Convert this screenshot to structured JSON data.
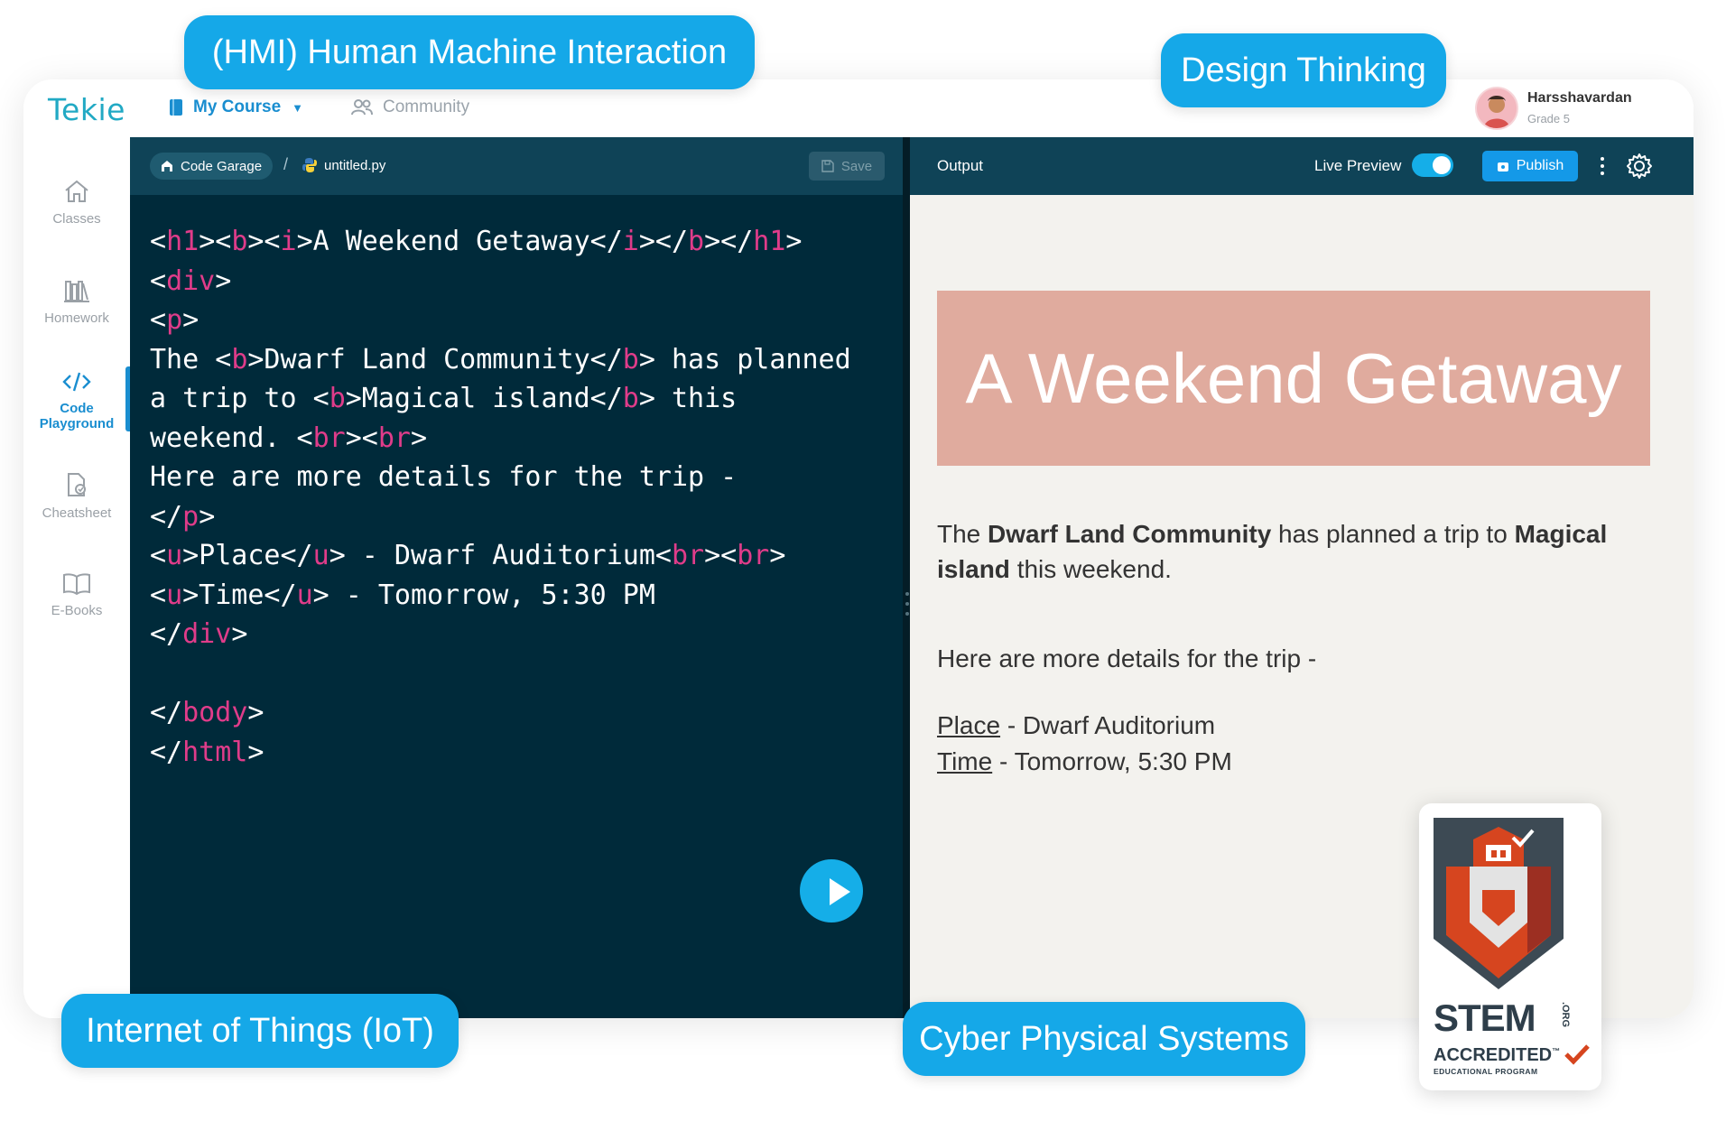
{
  "brand": {
    "logo": "Tekie"
  },
  "nav": {
    "my_course": "My Course",
    "community": "Community"
  },
  "user": {
    "name": "Harsshavardan",
    "grade": "Grade 5"
  },
  "sidebar": {
    "items": [
      {
        "label": "Classes",
        "icon": "home-icon"
      },
      {
        "label": "Homework",
        "icon": "books-icon"
      },
      {
        "label_line1": "Code",
        "label_line2": "Playground",
        "icon": "code-icon",
        "active": true
      },
      {
        "label": "Cheatsheet",
        "icon": "cheatsheet-icon"
      },
      {
        "label": "E-Books",
        "icon": "book-open-icon"
      }
    ]
  },
  "editor": {
    "breadcrumb_root": "Code Garage",
    "separator": "/",
    "file_name": "untitled.py",
    "save_label": "Save",
    "code_lines": [
      [
        {
          "t": "<",
          "c": "w"
        },
        {
          "t": "h1",
          "c": "p"
        },
        {
          "t": "><",
          "c": "w"
        },
        {
          "t": "b",
          "c": "p"
        },
        {
          "t": "><",
          "c": "w"
        },
        {
          "t": "i",
          "c": "p"
        },
        {
          "t": ">A Weekend Getaway</",
          "c": "w"
        },
        {
          "t": "i",
          "c": "p"
        },
        {
          "t": "></",
          "c": "w"
        },
        {
          "t": "b",
          "c": "p"
        },
        {
          "t": "></",
          "c": "w"
        },
        {
          "t": "h1",
          "c": "p"
        },
        {
          "t": ">",
          "c": "w"
        }
      ],
      [
        {
          "t": "<",
          "c": "w"
        },
        {
          "t": "div",
          "c": "p"
        },
        {
          "t": ">",
          "c": "w"
        }
      ],
      [
        {
          "t": "<",
          "c": "w"
        },
        {
          "t": "p",
          "c": "p"
        },
        {
          "t": ">",
          "c": "w"
        }
      ],
      [
        {
          "t": "The <",
          "c": "w"
        },
        {
          "t": "b",
          "c": "p"
        },
        {
          "t": ">Dwarf Land Community</",
          "c": "w"
        },
        {
          "t": "b",
          "c": "p"
        },
        {
          "t": "> has planned",
          "c": "w"
        }
      ],
      [
        {
          "t": "a trip to <",
          "c": "w"
        },
        {
          "t": "b",
          "c": "p"
        },
        {
          "t": ">Magical island</",
          "c": "w"
        },
        {
          "t": "b",
          "c": "p"
        },
        {
          "t": "> this",
          "c": "w"
        }
      ],
      [
        {
          "t": "weekend. <",
          "c": "w"
        },
        {
          "t": "br",
          "c": "p"
        },
        {
          "t": "><",
          "c": "w"
        },
        {
          "t": "br",
          "c": "p"
        },
        {
          "t": ">",
          "c": "w"
        }
      ],
      [
        {
          "t": "Here are more details for the trip -",
          "c": "w"
        }
      ],
      [
        {
          "t": "</",
          "c": "w"
        },
        {
          "t": "p",
          "c": "p"
        },
        {
          "t": ">",
          "c": "w"
        }
      ],
      [
        {
          "t": "<",
          "c": "w"
        },
        {
          "t": "u",
          "c": "p"
        },
        {
          "t": ">Place</",
          "c": "w"
        },
        {
          "t": "u",
          "c": "p"
        },
        {
          "t": "> - Dwarf Auditorium<",
          "c": "w"
        },
        {
          "t": "br",
          "c": "p"
        },
        {
          "t": "><",
          "c": "w"
        },
        {
          "t": "br",
          "c": "p"
        },
        {
          "t": ">",
          "c": "w"
        }
      ],
      [
        {
          "t": "<",
          "c": "w"
        },
        {
          "t": "u",
          "c": "p"
        },
        {
          "t": ">Time</",
          "c": "w"
        },
        {
          "t": "u",
          "c": "p"
        },
        {
          "t": "> - Tomorrow, 5:30 PM",
          "c": "w"
        }
      ],
      [
        {
          "t": "</",
          "c": "w"
        },
        {
          "t": "div",
          "c": "p"
        },
        {
          "t": ">",
          "c": "w"
        }
      ],
      [],
      [
        {
          "t": "</",
          "c": "w"
        },
        {
          "t": "body",
          "c": "p"
        },
        {
          "t": ">",
          "c": "w"
        }
      ],
      [
        {
          "t": "</",
          "c": "w"
        },
        {
          "t": "html",
          "c": "p"
        },
        {
          "t": ">",
          "c": "w"
        }
      ]
    ]
  },
  "output": {
    "title": "Output",
    "live_preview_label": "Live Preview",
    "live_preview_on": true,
    "publish_label": "Publish",
    "heading": "A Weekend Getaway",
    "para": {
      "t1": "The ",
      "b1": "Dwarf Land Community",
      "t2": " has planned a trip to ",
      "b2": "Magical island",
      "t3": " this weekend."
    },
    "details": "Here are more details for the trip -",
    "place_label": "Place",
    "place_value": " - Dwarf Auditorium",
    "time_label": "Time",
    "time_value": " - Tomorrow, 5:30 PM"
  },
  "pills": {
    "hmi": "(HMI) Human Machine Interaction",
    "design": "Design Thinking",
    "iot": "Internet of Things (IoT)",
    "cps": "Cyber Physical Systems"
  },
  "badge": {
    "stem": "STEM",
    "org": ".ORG",
    "accredited": "ACCREDITED",
    "tm": "™",
    "program": "EDUCATIONAL PROGRAM"
  },
  "colors": {
    "accent": "#15a8e8",
    "editor_bg": "#002a3a",
    "toolbar_bg": "#0f4357",
    "tag_pink": "#e03c8a",
    "banner": "#e0ab9e",
    "preview_bg": "#f3f2ee"
  }
}
